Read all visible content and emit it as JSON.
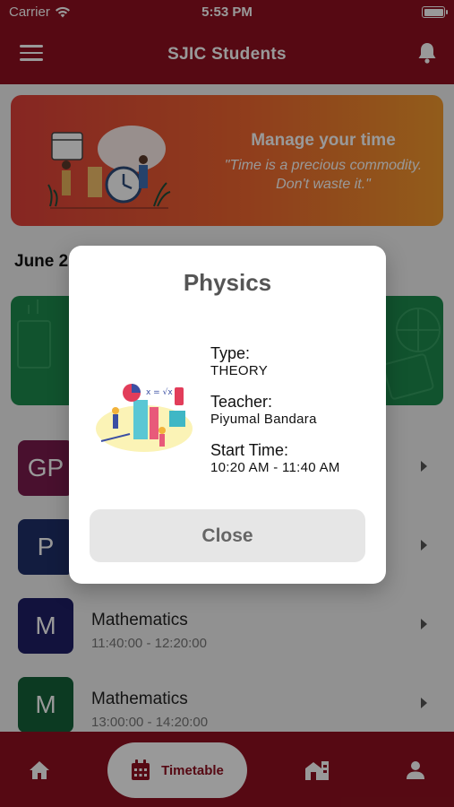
{
  "status_bar": {
    "carrier": "Carrier",
    "time": "5:53 PM"
  },
  "app_bar": {
    "title": "SJIC Students"
  },
  "banner": {
    "heading": "Manage your time",
    "quote": "\"Time is a precious commodity.\nDon't waste it.\""
  },
  "date_label": "June 2",
  "colors": {
    "primary": "#8f1020",
    "banner_start": "#e0403a",
    "banner_end": "#f39a2d",
    "green_card": "#1d8a4e"
  },
  "schedule": [
    {
      "initials": "GP",
      "subject": "",
      "time": "",
      "color": "#7b1b4e"
    },
    {
      "initials": "P",
      "subject": "",
      "time": "",
      "color": "#1f2f6a"
    },
    {
      "initials": "M",
      "subject": "Mathematics",
      "time": "11:40:00 - 12:20:00",
      "color": "#1e1e66"
    },
    {
      "initials": "M",
      "subject": "Mathematics",
      "time": "13:00:00 - 14:20:00",
      "color": "#15623a"
    }
  ],
  "bottom_nav": {
    "timetable_label": "Timetable",
    "active": "timetable"
  },
  "dialog": {
    "title": "Physics",
    "type_label": "Type:",
    "type_value": "THEORY",
    "teacher_label": "Teacher:",
    "teacher_value": "Piyumal Bandara",
    "start_label": "Start Time:",
    "start_value": "10:20 AM - 11:40 AM",
    "close_label": "Close"
  }
}
